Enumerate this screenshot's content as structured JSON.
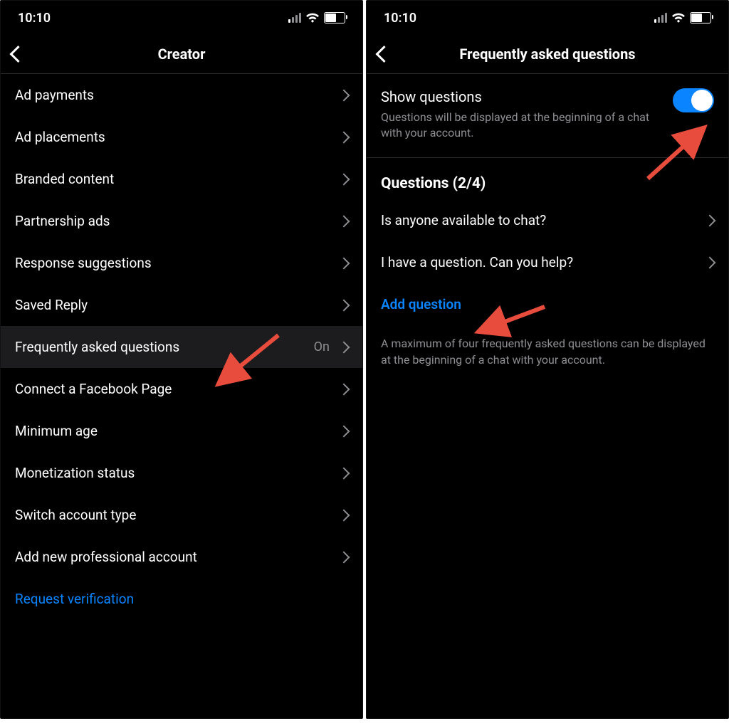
{
  "status": {
    "time": "10:10"
  },
  "screen_left": {
    "title": "Creator",
    "items": [
      {
        "label": "Ad payments"
      },
      {
        "label": "Ad placements"
      },
      {
        "label": "Branded content"
      },
      {
        "label": "Partnership ads"
      },
      {
        "label": "Response suggestions"
      },
      {
        "label": "Saved Reply"
      },
      {
        "label": "Frequently asked questions",
        "value": "On",
        "highlight": true
      },
      {
        "label": "Connect a Facebook Page"
      },
      {
        "label": "Minimum age"
      },
      {
        "label": "Monetization status"
      },
      {
        "label": "Switch account type"
      },
      {
        "label": "Add new professional account"
      }
    ],
    "link": "Request verification"
  },
  "screen_right": {
    "title": "Frequently asked questions",
    "show_questions": {
      "title": "Show questions",
      "subtitle": "Questions will be displayed at the beginning of a chat with your account.",
      "enabled": true
    },
    "questions_header": "Questions (2/4)",
    "questions": [
      {
        "label": "Is anyone available to chat?"
      },
      {
        "label": "I have a question. Can you help?"
      }
    ],
    "add_question": "Add question",
    "footnote": "A maximum of four frequently asked questions can be displayed at the beginning of a chat with your account."
  }
}
